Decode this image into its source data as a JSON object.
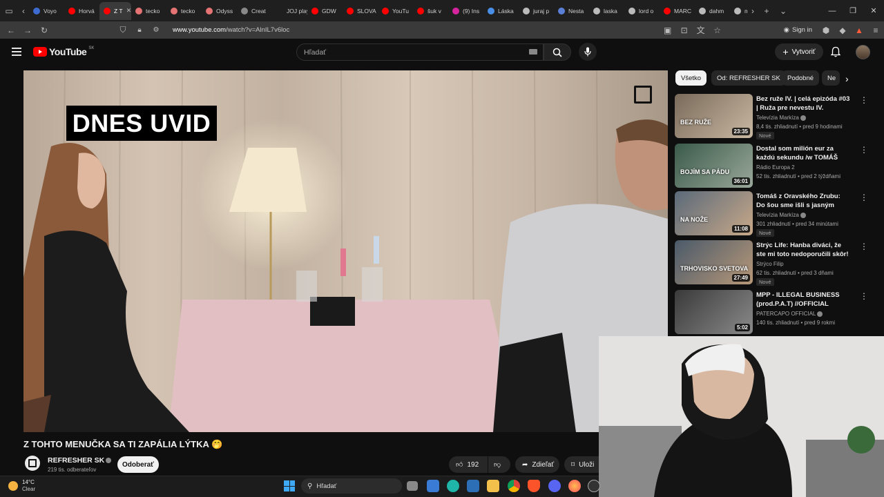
{
  "browser": {
    "tabs": [
      {
        "label": "Voyo",
        "color": "#3d6bd1"
      },
      {
        "label": "Horvá",
        "color": "#ff0000"
      },
      {
        "label": "Z T",
        "color": "#ff0000",
        "active": true
      },
      {
        "label": "tecko",
        "color": "#e57373"
      },
      {
        "label": "tecko",
        "color": "#e57373"
      },
      {
        "label": "Odyss",
        "color": "#e57373"
      },
      {
        "label": "Creat",
        "color": "#888888"
      },
      {
        "label": "JOJ play",
        "color": "#1f1f1f"
      },
      {
        "label": "GDW",
        "color": "#ff0000"
      },
      {
        "label": "SLOVA",
        "color": "#ff0000"
      },
      {
        "label": "YouTu",
        "color": "#ff0000"
      },
      {
        "label": "šuk v",
        "color": "#ff0000"
      },
      {
        "label": "(9) Ins",
        "color": "#d6249f"
      },
      {
        "label": "Láska",
        "color": "#4a8fe7"
      },
      {
        "label": "juraj p",
        "color": "#bbbbbb"
      },
      {
        "label": "Nesta",
        "color": "#5b7fd6"
      },
      {
        "label": "laska",
        "color": "#bbbbbb"
      },
      {
        "label": "lord o",
        "color": "#bbbbbb"
      },
      {
        "label": "MARC",
        "color": "#ff0000"
      },
      {
        "label": "dahm",
        "color": "#bbbbbb"
      },
      {
        "label": "m",
        "color": "#bbbbbb"
      }
    ],
    "url_host": "www.youtube.com",
    "url_path": "/watch?v=AlnIL7v6loc",
    "signin_label": "Sign in"
  },
  "youtube": {
    "logo_text": "YouTube",
    "logo_region": "SK",
    "search_placeholder": "Hľadať",
    "create_label": "Vytvoriť"
  },
  "video": {
    "overlay_caption": "DNES UVID",
    "title": "Z TOHTO MENUČKA SA TI ZAPÁLIA LÝTKA 🤭",
    "channel_name": "REFRESHER SK",
    "channel_subs": "219 tis. odberateľov",
    "subscribe_label": "Odoberať",
    "likes": "192",
    "share_label": "Zdieľať",
    "save_label": "Uloži"
  },
  "sidebar": {
    "chips": [
      "Všetko",
      "Od: REFRESHER SK",
      "Podobné",
      "Ne"
    ],
    "recommendations": [
      {
        "title": "Bez ruže IV. | celá epizóda #03 | Ruža pre nevestu IV.",
        "channel": "Televízia Markíza",
        "verified": true,
        "meta": "8,4 tis. zhliadnutí • pred 9 hodinami",
        "badge": "Nové",
        "duration": "23:35",
        "thumb_text": "BEZ RUŽE",
        "thumb_colors": [
          "#7a6a5a",
          "#c9b8a2"
        ]
      },
      {
        "title": "Dostal som milión eur za každú sekundu /w TOMÁŠ KRIŽAN | ...",
        "channel": "Rádio Europa 2",
        "verified": false,
        "meta": "52 tis. zhliadnutí • pred 2 týždňami",
        "badge": "",
        "duration": "36:01",
        "thumb_text": "BOJÍM SA PÁDU",
        "thumb_colors": [
          "#3a5a4a",
          "#9aa89a"
        ]
      },
      {
        "title": "Tomáš z Oravského Zrubu: Do šou sme išli s jasným cieľom, ...",
        "channel": "Televízia Markíza",
        "verified": true,
        "meta": "301 zhliadnutí • pred 34 minútami",
        "badge": "Nové",
        "duration": "11:08",
        "thumb_text": "NA NOŽE",
        "thumb_colors": [
          "#5a6a7a",
          "#c8a888"
        ]
      },
      {
        "title": "Strýc Life: Hanba diváci, že ste mi toto nedoporučili skôr! Toto...",
        "channel": "Strýco Filip",
        "verified": false,
        "meta": "62 tis. zhliadnutí • pred 3 dňami",
        "badge": "Nové",
        "duration": "27:49",
        "thumb_text": "TRHOVISKO SVETOVA",
        "thumb_colors": [
          "#4a5a6a",
          "#b89878"
        ]
      },
      {
        "title": "MPP - ILLEGAL BUSINESS (prod.P.A.T) //OFFICIAL STOK...",
        "channel": "PATERCAPO OFFICIAL",
        "verified": true,
        "meta": "140 tis. zhliadnutí • pred 9 rokmi",
        "badge": "",
        "duration": "5:02",
        "thumb_text": "",
        "thumb_colors": [
          "#3a3a3a",
          "#8a8a8a"
        ]
      }
    ]
  },
  "taskbar": {
    "weather_temp": "14°C",
    "weather_desc": "Clear",
    "search_label": "Hľadať"
  }
}
